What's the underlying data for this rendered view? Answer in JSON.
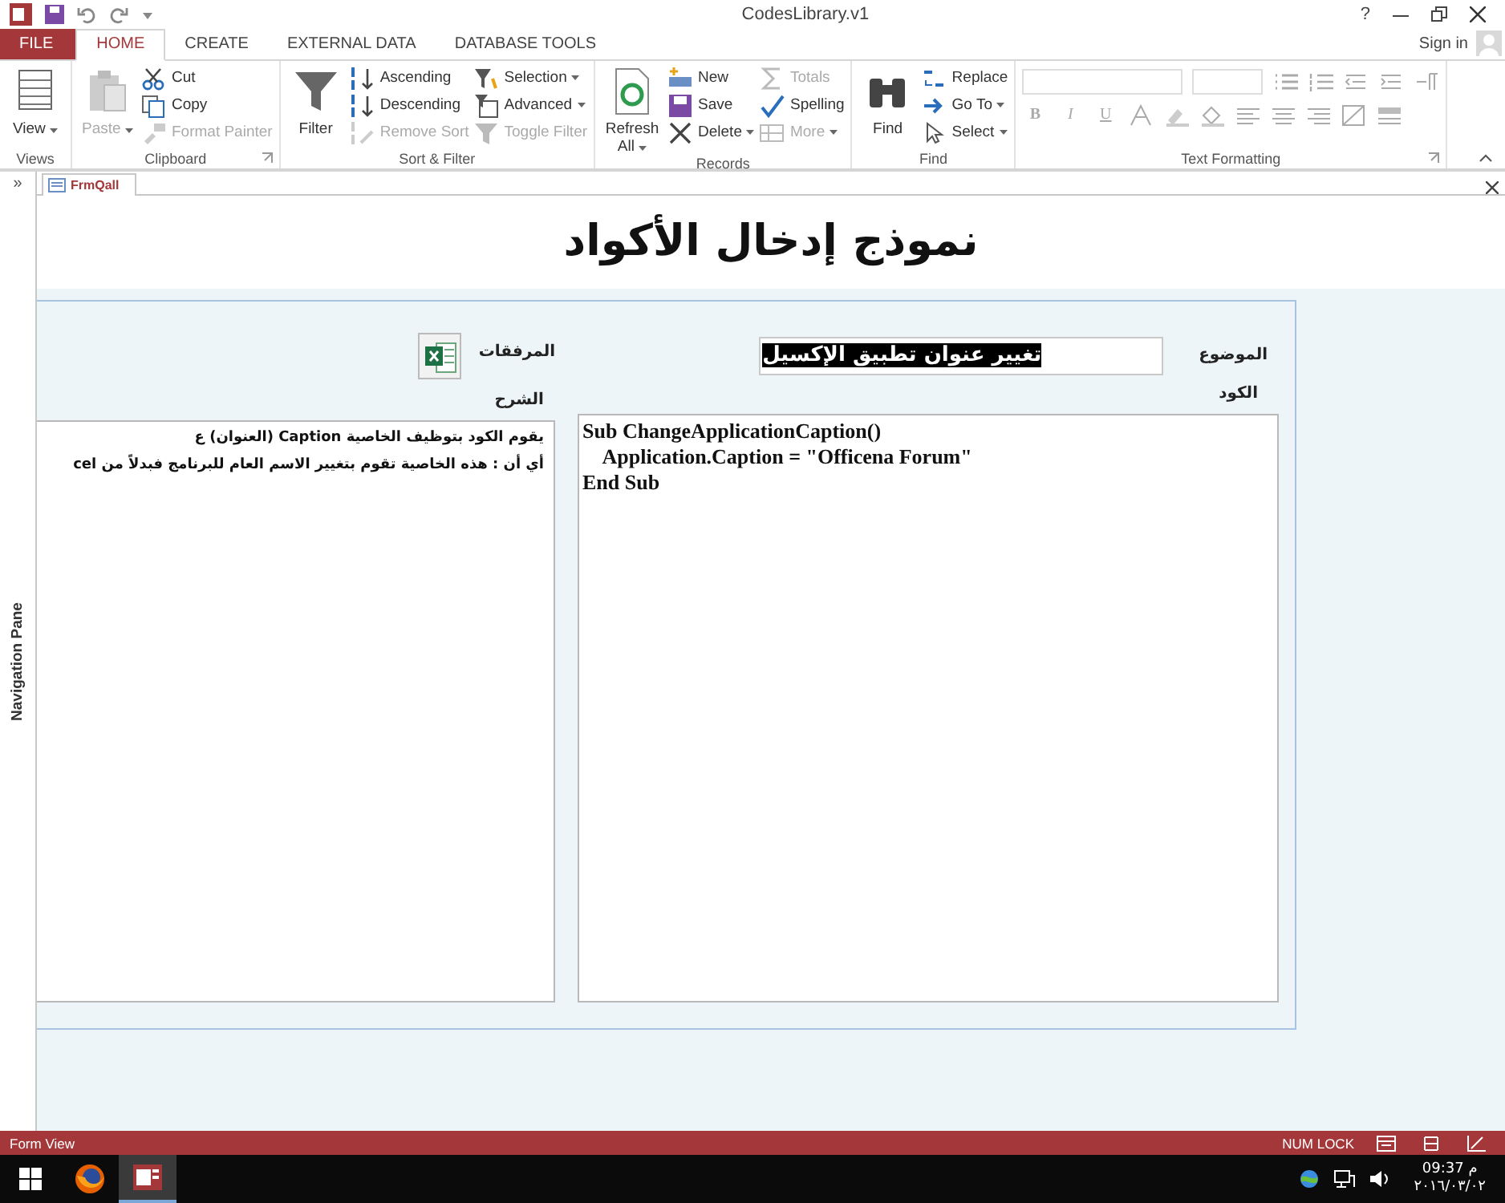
{
  "window": {
    "title": "CodesLibrary.v1",
    "help": "?",
    "sign_in": "Sign in"
  },
  "ribbon_tabs": [
    {
      "label": "FILE",
      "kind": "file",
      "selected": false
    },
    {
      "label": "HOME",
      "kind": "tab",
      "selected": true
    },
    {
      "label": "CREATE",
      "kind": "tab",
      "selected": false
    },
    {
      "label": "EXTERNAL DATA",
      "kind": "tab",
      "selected": false
    },
    {
      "label": "DATABASE TOOLS",
      "kind": "tab",
      "selected": false
    }
  ],
  "ribbon_groups": [
    {
      "name": "Views",
      "kind": "commands",
      "launcher": false,
      "items": [
        {
          "label": "View",
          "kind": "large",
          "dropdown": true,
          "disabled": false
        }
      ]
    },
    {
      "name": "Clipboard",
      "kind": "commands",
      "launcher": true,
      "items": [
        {
          "label": "Paste",
          "kind": "large",
          "dropdown": true,
          "disabled": true
        },
        {
          "label": "Cut",
          "kind": "small",
          "dropdown": false,
          "disabled": false
        },
        {
          "label": "Copy",
          "kind": "small",
          "dropdown": false,
          "disabled": false
        },
        {
          "label": "Format Painter",
          "kind": "small",
          "dropdown": false,
          "disabled": true
        }
      ]
    },
    {
      "name": "Sort & Filter",
      "kind": "commands",
      "launcher": false,
      "items": [
        {
          "label": "Filter",
          "kind": "large",
          "dropdown": false,
          "disabled": false
        },
        {
          "label": "Ascending",
          "kind": "small",
          "dropdown": false,
          "disabled": false
        },
        {
          "label": "Descending",
          "kind": "small",
          "dropdown": false,
          "disabled": false
        },
        {
          "label": "Remove Sort",
          "kind": "small",
          "dropdown": false,
          "disabled": true
        },
        {
          "label": "Selection",
          "kind": "small",
          "dropdown": true,
          "disabled": false
        },
        {
          "label": "Advanced",
          "kind": "small",
          "dropdown": true,
          "disabled": false
        },
        {
          "label": "Toggle Filter",
          "kind": "small",
          "dropdown": false,
          "disabled": true
        }
      ]
    },
    {
      "name": "Records",
      "kind": "commands",
      "launcher": false,
      "items": [
        {
          "label": "Refresh All",
          "kind": "large",
          "dropdown": true,
          "disabled": false
        },
        {
          "label": "New",
          "kind": "small",
          "dropdown": false,
          "disabled": false
        },
        {
          "label": "Save",
          "kind": "small",
          "dropdown": false,
          "disabled": false
        },
        {
          "label": "Delete",
          "kind": "small",
          "dropdown": true,
          "disabled": false
        },
        {
          "label": "Totals",
          "kind": "small",
          "dropdown": false,
          "disabled": true
        },
        {
          "label": "Spelling",
          "kind": "small",
          "dropdown": false,
          "disabled": false
        },
        {
          "label": "More",
          "kind": "small",
          "dropdown": true,
          "disabled": true
        }
      ]
    },
    {
      "name": "Find",
      "kind": "commands",
      "launcher": false,
      "items": [
        {
          "label": "Find",
          "kind": "large",
          "dropdown": false,
          "disabled": false
        },
        {
          "label": "Replace",
          "kind": "small",
          "dropdown": false,
          "disabled": false
        },
        {
          "label": "Go To",
          "kind": "small",
          "dropdown": true,
          "disabled": false
        },
        {
          "label": "Select",
          "kind": "small",
          "dropdown": true,
          "disabled": false
        }
      ]
    },
    {
      "name": "Text Formatting",
      "kind": "format",
      "launcher": true,
      "items": [
        {
          "label": "B",
          "kind": "bold",
          "disabled": true
        },
        {
          "label": "I",
          "kind": "italic",
          "disabled": true
        },
        {
          "label": "U",
          "kind": "underline",
          "disabled": true
        }
      ]
    }
  ],
  "document_tab": {
    "label": "FrmQall",
    "selected": true
  },
  "navigation_pane": {
    "label": "Navigation Pane",
    "toggle": "»"
  },
  "form": {
    "title": "نموذج إدخال الأكواد",
    "subject": {
      "label": "الموضوع",
      "value": "تغيير عنوان تطبيق الإكسيل",
      "text_selected": true
    },
    "code": {
      "label": "الكود",
      "lines": [
        "Sub ChangeApplicationCaption()",
        "    Application.Caption = \"Officena Forum\"",
        "End Sub"
      ]
    },
    "attachments": {
      "label": "المرفقات"
    },
    "explanation": {
      "label": "الشرح",
      "lines": [
        "يقوم الكود بتوظيف الخاصية Caption (العنوان) ع",
        "أي أن : هذه الخاصية تقوم بتغيير الاسم العام للبرنامج فبدلاً من cel"
      ]
    }
  },
  "status_bar": {
    "left": "Form View",
    "indicator": "NUM LOCK"
  },
  "taskbar": {
    "apps": [
      {
        "selected": false
      },
      {
        "selected": true
      }
    ],
    "time": "09:37 م",
    "date": "٢٠١٦/٠٣/٠٢"
  }
}
